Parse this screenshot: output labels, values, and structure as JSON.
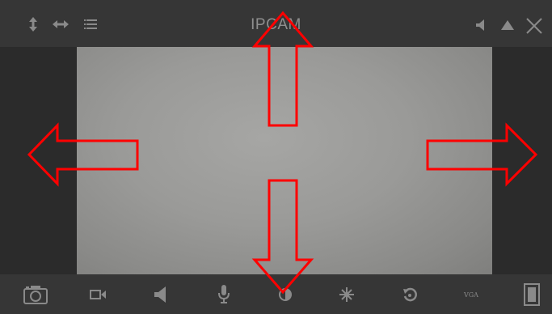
{
  "window": {
    "title": "IPCAM"
  },
  "toolbar_top": {
    "left_icons": [
      "vertical-flip-icon",
      "horizontal-flip-icon",
      "menu-icon"
    ],
    "right_icons": [
      "speaker-icon",
      "warning-icon",
      "close-icon"
    ]
  },
  "toolbar_bottom": {
    "icons": [
      "camera-snapshot-icon",
      "video-record-icon",
      "speaker-icon",
      "microphone-icon",
      "contrast-icon",
      "brightness-icon",
      "rotate-icon",
      "resolution-icon",
      "portrait-mode-icon"
    ],
    "resolution_label": "VGA"
  },
  "overlay_arrows": [
    "up",
    "down",
    "left",
    "right"
  ],
  "colors": {
    "arrow_stroke": "#ff0000",
    "bar_background": "#373737",
    "icon": "#8a8a8a"
  }
}
